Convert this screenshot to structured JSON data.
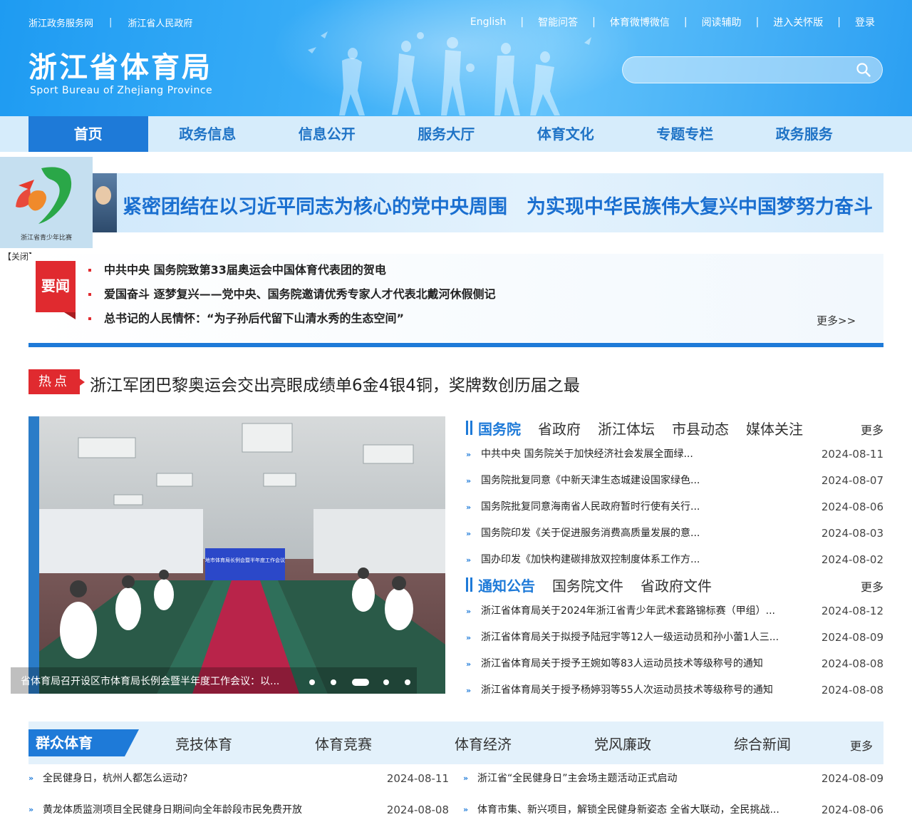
{
  "header": {
    "top_left_links": [
      "浙江政务服务网",
      "浙江省人民政府"
    ],
    "top_right_links": [
      "English",
      "智能问答",
      "体育微博微信",
      "阅读辅助",
      "进入关怀版",
      "登录"
    ],
    "logo_cn": "浙江省体育局",
    "logo_en": "Sport Bureau of Zhejiang Province",
    "search_placeholder": ""
  },
  "nav": [
    "首页",
    "政务信息",
    "信息公开",
    "服务大厅",
    "体育文化",
    "专题专栏",
    "政务服务"
  ],
  "float_ad": {
    "caption": "浙江省青少年比赛",
    "close_label": "【关闭】"
  },
  "banner": {
    "text": "紧密团结在以习近平同志为核心的党中央周围　为实现中华民族伟大复兴中国梦努力奋斗"
  },
  "yaowen": {
    "tag": "要闻",
    "items": [
      "中共中央 国务院致第33届奥运会中国体育代表团的贺电",
      "爱国奋斗 逐梦复兴——党中央、国务院邀请优秀专家人才代表北戴河休假侧记",
      "总书记的人民情怀：“为子孙后代留下山清水秀的生态空间”"
    ],
    "more": "更多>>"
  },
  "hot": {
    "tag": "热点",
    "text": "浙江军团巴黎奥运会交出亮眼成绩单6金4银4铜，奖牌数创历届之最"
  },
  "photo": {
    "caption": "省体育局召开设区市体育局长例会暨半年度工作会议：以...",
    "screen_text": "地市体育局长例会暨半年度工作会议"
  },
  "news_panel_1": {
    "tabs": [
      "国务院",
      "省政府",
      "浙江体坛",
      "市县动态",
      "媒体关注"
    ],
    "more": "更多",
    "items": [
      {
        "title": "中共中央 国务院关于加快经济社会发展全面绿...",
        "date": "2024-08-11"
      },
      {
        "title": "国务院批复同意《中新天津生态城建设国家绿色...",
        "date": "2024-08-07"
      },
      {
        "title": "国务院批复同意海南省人民政府暂时行使有关行...",
        "date": "2024-08-06"
      },
      {
        "title": "国务院印发《关于促进服务消费高质量发展的意...",
        "date": "2024-08-03"
      },
      {
        "title": "国办印发《加快构建碳排放双控制度体系工作方...",
        "date": "2024-08-02"
      }
    ]
  },
  "news_panel_2": {
    "tabs": [
      "通知公告",
      "国务院文件",
      "省政府文件"
    ],
    "more": "更多",
    "items": [
      {
        "title": "浙江省体育局关于2024年浙江省青少年武术套路锦标赛（甲组）...",
        "date": "2024-08-12"
      },
      {
        "title": "浙江省体育局关于拟授予陆冠宇等12人一级运动员和孙小蕾1人三...",
        "date": "2024-08-09"
      },
      {
        "title": "浙江省体育局关于授予王婉如等83人运动员技术等级称号的通知",
        "date": "2024-08-08"
      },
      {
        "title": "浙江省体育局关于授予杨婷羽等55人次运动员技术等级称号的通知",
        "date": "2024-08-08"
      }
    ]
  },
  "bottom": {
    "tag": "群众体育",
    "tabs": [
      "竞技体育",
      "体育竞赛",
      "体育经济",
      "党风廉政",
      "综合新闻"
    ],
    "more": "更多",
    "left_items": [
      {
        "title": "全民健身日，杭州人都怎么运动?",
        "date": "2024-08-11"
      },
      {
        "title": "黄龙体质监测项目全民健身日期间向全年龄段市民免费开放",
        "date": "2024-08-08"
      }
    ],
    "right_items": [
      {
        "title": "浙江省“全民健身日”主会场主题活动正式启动",
        "date": "2024-08-09"
      },
      {
        "title": "体育市集、新兴项目，解锁全民健身新姿态 全省大联动，全民挑战...",
        "date": "2024-08-06"
      }
    ]
  },
  "list_arrow": "»",
  "colors": {
    "primary": "#1e7ad8",
    "red": "#e02a2f",
    "nav_bg": "#d6ecfb"
  }
}
